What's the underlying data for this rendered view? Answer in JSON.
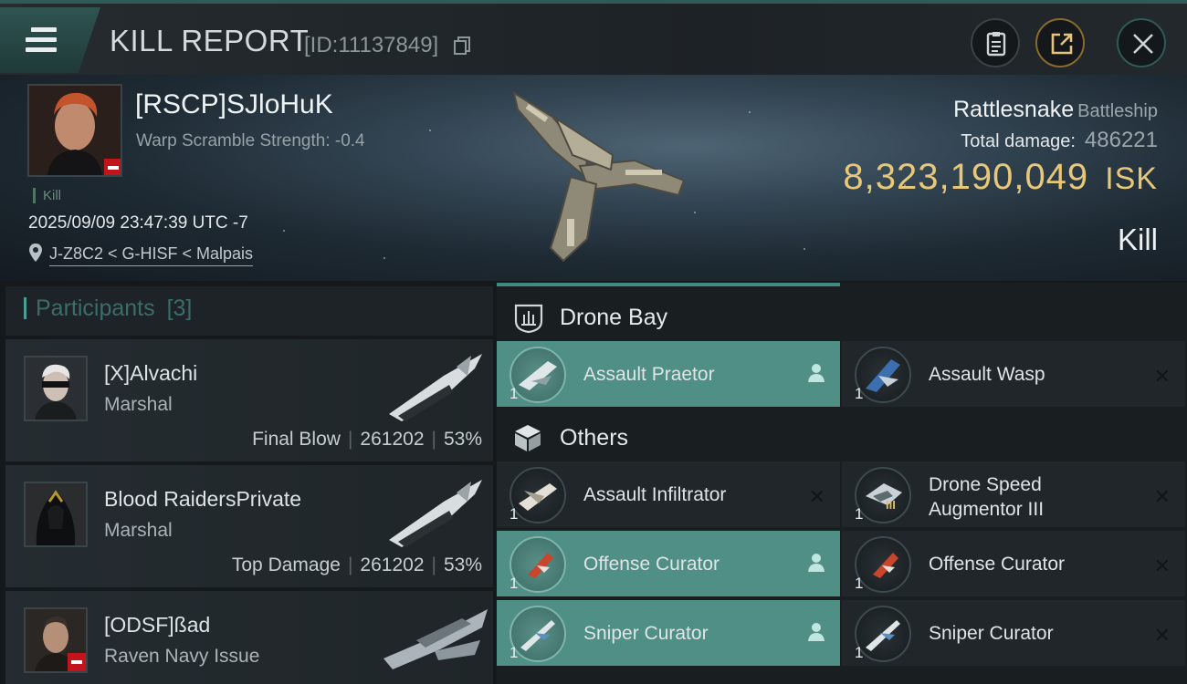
{
  "header": {
    "title": "KILL REPORT",
    "report_id": "[ID:11137849]"
  },
  "victim": {
    "name": "[RSCP]SJloHuK",
    "warp_scramble": "Warp Scramble Strength: -0.4",
    "kill_tag": "Kill",
    "datetime": "2025/09/09 23:47:39 UTC -7",
    "location": "J-Z8C2 < G-HISF < Malpais",
    "ship_name": "Rattlesnake",
    "ship_class": "Battleship",
    "total_damage_label": "Total damage:",
    "total_damage": "486221",
    "isk_value": "8,323,190,049",
    "isk_unit": "ISK",
    "kill_type": "Kill"
  },
  "participants": {
    "label": "Participants",
    "count": "[3]",
    "rows": [
      {
        "name": "[X]Alvachi",
        "ship": "Marshal",
        "role": "Final Blow",
        "damage": "261202",
        "percent": "53%"
      },
      {
        "name": "Blood RaidersPrivate",
        "ship": "Marshal",
        "role": "Top Damage",
        "damage": "261202",
        "percent": "53%"
      },
      {
        "name": "[ODSF]ßad",
        "ship": "Raven Navy Issue"
      }
    ]
  },
  "modules": {
    "drone_bay": {
      "label": "Drone Bay",
      "items": [
        {
          "name": "Assault Praetor",
          "qty": "1",
          "status": "dropped"
        },
        {
          "name": "Assault Wasp",
          "qty": "1",
          "status": "destroyed"
        }
      ]
    },
    "others": {
      "label": "Others",
      "items": [
        {
          "name": "Assault Infiltrator",
          "qty": "1",
          "status": "destroyed"
        },
        {
          "name_line1": "Drone Speed",
          "name_line2": "Augmentor III",
          "qty": "1",
          "status": "destroyed",
          "meta": "III"
        },
        {
          "name": "Offense  Curator",
          "qty": "1",
          "status": "dropped"
        },
        {
          "name": "Offense  Curator",
          "qty": "1",
          "status": "destroyed"
        },
        {
          "name": "Sniper  Curator",
          "qty": "1",
          "status": "dropped"
        },
        {
          "name": "Sniper  Curator",
          "qty": "1",
          "status": "destroyed"
        }
      ]
    }
  },
  "colors": {
    "accent_teal": "#4f8f86",
    "isk_gold": "#e7c779",
    "danger_red": "#c1141b"
  }
}
